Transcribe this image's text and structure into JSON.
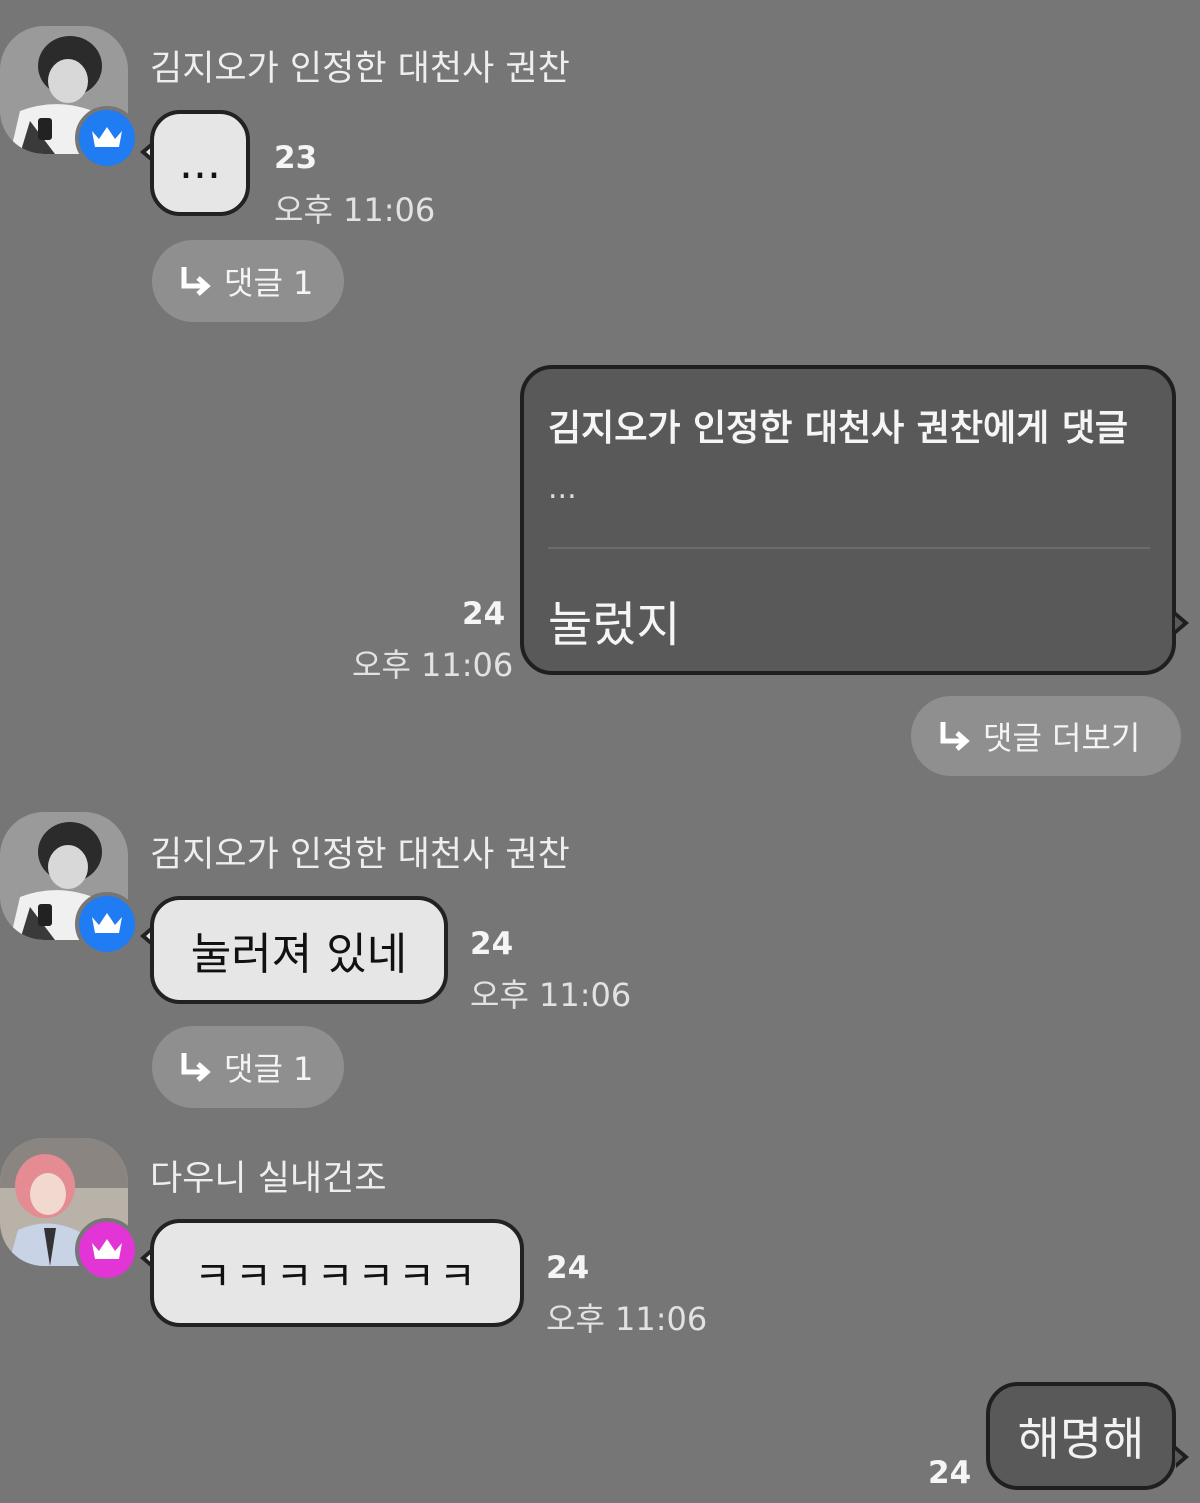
{
  "messages": [
    {
      "sender": "김지오가 인정한 대천사 권찬",
      "text": "...",
      "count": "23",
      "time": "오후 11:06",
      "reply_label": "댓글 1",
      "badge_color": "#1f7cf3",
      "avatar": "avatar-monochrome-photo"
    },
    {
      "quote_header": "김지오가 인정한 대천사 권찬에게 댓글",
      "quote_text": "...",
      "text": "눌렀지",
      "count": "24",
      "time": "오후 11:06",
      "reply_label": "댓글 더보기"
    },
    {
      "sender": "김지오가 인정한 대천사 권찬",
      "text": "눌러져 있네",
      "count": "24",
      "time": "오후 11:06",
      "reply_label": "댓글 1",
      "badge_color": "#1f7cf3",
      "avatar": "avatar-monochrome-photo"
    },
    {
      "sender": "다우니 실내건조",
      "text": "ㅋㅋㅋㅋㅋㅋㅋ",
      "count": "24",
      "time": "오후 11:06",
      "badge_color": "#e334d6",
      "avatar": "avatar-pink-hair-photo"
    },
    {
      "text": "해명해",
      "count": "24"
    }
  ],
  "icons": {
    "reply_arrow": "reply-arrow-icon",
    "crown": "crown-icon"
  }
}
